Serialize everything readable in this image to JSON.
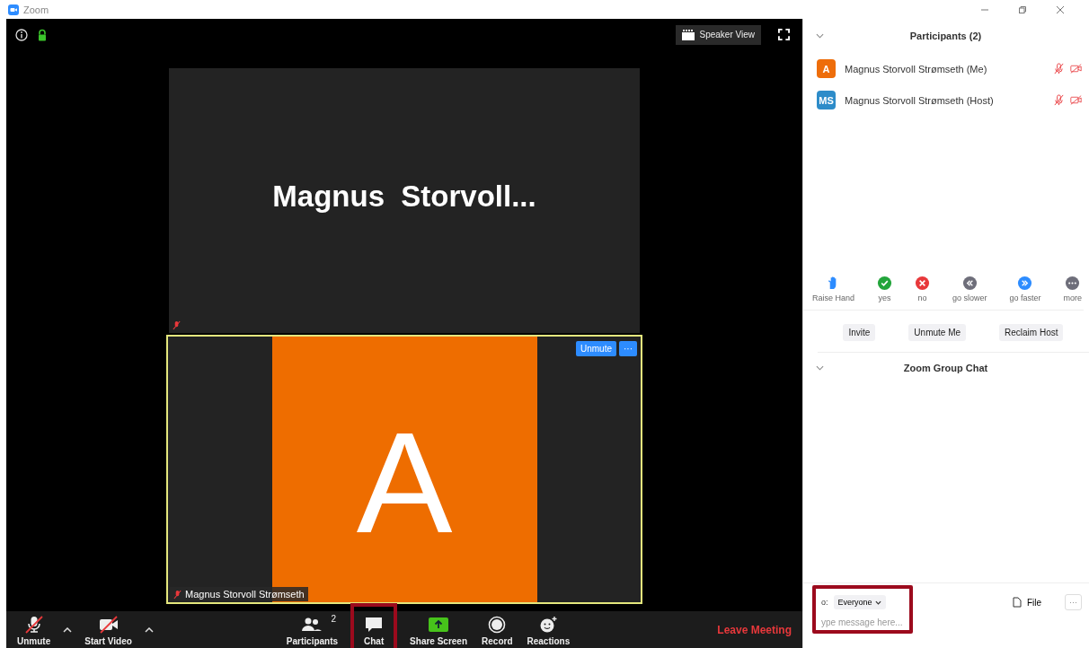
{
  "window": {
    "title": "Zoom"
  },
  "video": {
    "view_button": "Speaker View",
    "main_tile": {
      "name": "Magnus  Storvoll...",
      "muted": true
    },
    "self_tile": {
      "initial": "A",
      "name": "Magnus Storvoll Strømseth",
      "muted": true,
      "unmute_button": "Unmute",
      "more_button": "···"
    }
  },
  "toolbar": [
    {
      "kind": "mic",
      "label": "Unmute",
      "off": true,
      "has_menu": true
    },
    {
      "kind": "video",
      "label": "Start Video",
      "off": true,
      "has_menu": true
    },
    {
      "kind": "participants",
      "label": "Participants",
      "badge": "2",
      "off": false,
      "has_menu": false
    },
    {
      "kind": "chat",
      "label": "Chat",
      "off": false,
      "has_menu": false
    },
    {
      "kind": "share",
      "label": "Share Screen",
      "off": false,
      "has_menu": false
    },
    {
      "kind": "record",
      "label": "Record",
      "off": false,
      "has_menu": false
    },
    {
      "kind": "reactions",
      "label": "Reactions",
      "off": false,
      "has_menu": false
    }
  ],
  "leave_button": "Leave Meeting",
  "participants": {
    "title": "Participants (2)",
    "items": [
      {
        "initials": "A",
        "color": "#ee6d0a",
        "name": "Magnus Storvoll Strømseth (Me)",
        "muted": true,
        "video_off": true
      },
      {
        "initials": "MS",
        "color": "#2d8cc9",
        "name": "Magnus Storvoll Strømseth (Host)",
        "muted": true,
        "video_off": true
      }
    ],
    "feedback": [
      {
        "kind": "hand",
        "label": "Raise Hand",
        "color": "#2d8cff"
      },
      {
        "kind": "check",
        "label": "yes",
        "color": "#23a53b"
      },
      {
        "kind": "cross",
        "label": "no",
        "color": "#e8383b"
      },
      {
        "kind": "slower",
        "label": "go slower",
        "color": "#6e6e7a"
      },
      {
        "kind": "faster",
        "label": "go faster",
        "color": "#2d8cff"
      },
      {
        "kind": "more",
        "label": "more",
        "color": "#6e6e7a"
      }
    ],
    "buttons": [
      "Invite",
      "Unmute Me",
      "Reclaim Host"
    ]
  },
  "chat": {
    "title": "Zoom Group Chat",
    "to_label": "o:",
    "recipient": "Everyone",
    "file_button": "File",
    "more_button": "···",
    "placeholder": "ype message here..."
  }
}
